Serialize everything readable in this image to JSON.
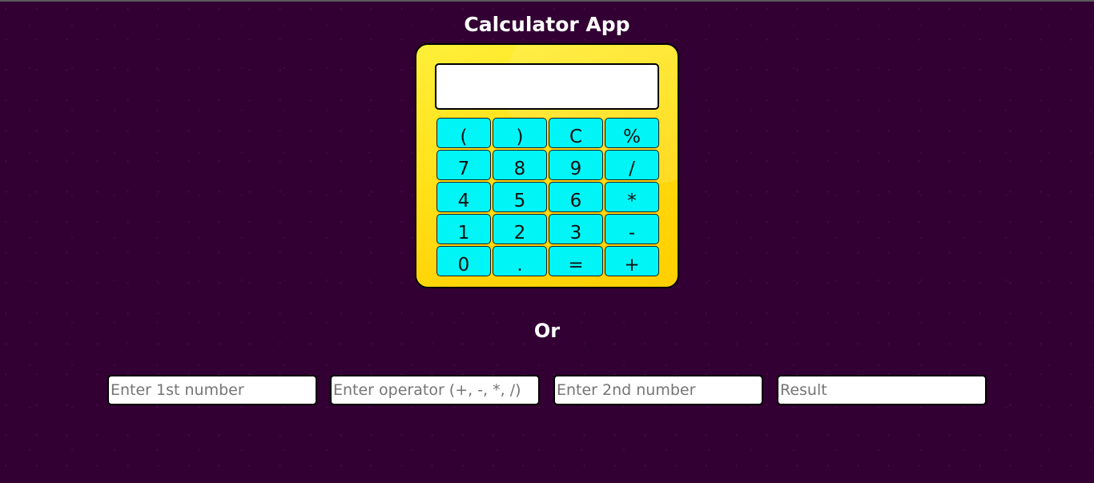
{
  "header": {
    "title": "Calculator App"
  },
  "calculator": {
    "display_value": "",
    "keys": [
      {
        "label": "(",
        "name": "key-open-paren"
      },
      {
        "label": ")",
        "name": "key-close-paren"
      },
      {
        "label": "C",
        "name": "key-clear"
      },
      {
        "label": "%",
        "name": "key-percent"
      },
      {
        "label": "7",
        "name": "key-7"
      },
      {
        "label": "8",
        "name": "key-8"
      },
      {
        "label": "9",
        "name": "key-9"
      },
      {
        "label": "/",
        "name": "key-divide"
      },
      {
        "label": "4",
        "name": "key-4"
      },
      {
        "label": "5",
        "name": "key-5"
      },
      {
        "label": "6",
        "name": "key-6"
      },
      {
        "label": "*",
        "name": "key-multiply"
      },
      {
        "label": "1",
        "name": "key-1"
      },
      {
        "label": "2",
        "name": "key-2"
      },
      {
        "label": "3",
        "name": "key-3"
      },
      {
        "label": "-",
        "name": "key-subtract"
      },
      {
        "label": "0",
        "name": "key-0"
      },
      {
        "label": ".",
        "name": "key-decimal"
      },
      {
        "label": "=",
        "name": "key-equals"
      },
      {
        "label": "+",
        "name": "key-add"
      }
    ]
  },
  "separator": {
    "label": "Or"
  },
  "form": {
    "first_number": {
      "value": "",
      "placeholder": "Enter 1st number"
    },
    "operator": {
      "value": "",
      "placeholder": "Enter operator (+, -, *, /)"
    },
    "second_number": {
      "value": "",
      "placeholder": "Enter 2nd number"
    },
    "result": {
      "value": "",
      "placeholder": "Result"
    }
  },
  "colors": {
    "background": "#320033",
    "calculator_body": "#ffe21a",
    "key": "#00f6f6",
    "text_light": "#ffffff"
  }
}
